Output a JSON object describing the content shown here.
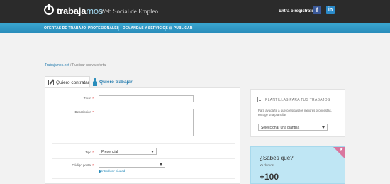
{
  "header": {
    "logo_text": "trabaja",
    "logo_text_hl": "mos",
    "tagline": "Web Social de Empleo",
    "login_link": "Entra o regístrate",
    "facebook_glyph": "f",
    "linkedin_glyph": "in"
  },
  "nav": {
    "items": [
      {
        "label": "OFERTAS DE TRABAJO"
      },
      {
        "label": "PROFESIONALES"
      },
      {
        "label": "DEMANDAS Y SERVICIOS"
      },
      {
        "label": "⊞ PUBLICAR"
      }
    ]
  },
  "breadcrumb": {
    "home": "Trabajamos.net",
    "separator": " / ",
    "current": "Publicar nueva oferta"
  },
  "tabs": {
    "hire": "Quiero contratar",
    "work": "Quiero trabajar"
  },
  "form": {
    "title_label": "Título",
    "description_label": "Descripción",
    "type_label": "Tipo",
    "type_value": "Presencial",
    "postal_label": "Código postal",
    "postal_hint": "Introducir ciudad",
    "required_mark": "*"
  },
  "templates": {
    "title": "PLANTILLAS PARA TUS TRABAJOS",
    "description": "Para ayudarte a que consigas los mejores propuestas, escoge una plantilla!",
    "select_value": "Seleccionar una plantilla"
  },
  "promo": {
    "title": "¿Sabes qué?",
    "subtitle": "Ya damos",
    "number": "+100",
    "ribbon_icon": "★"
  },
  "colors": {
    "topbar": "#2b2b2b",
    "navbar": "#2a8dbb",
    "accent": "#2a8dbb",
    "promo_bg": "#bfe6f4",
    "ribbon": "#d9779f"
  }
}
